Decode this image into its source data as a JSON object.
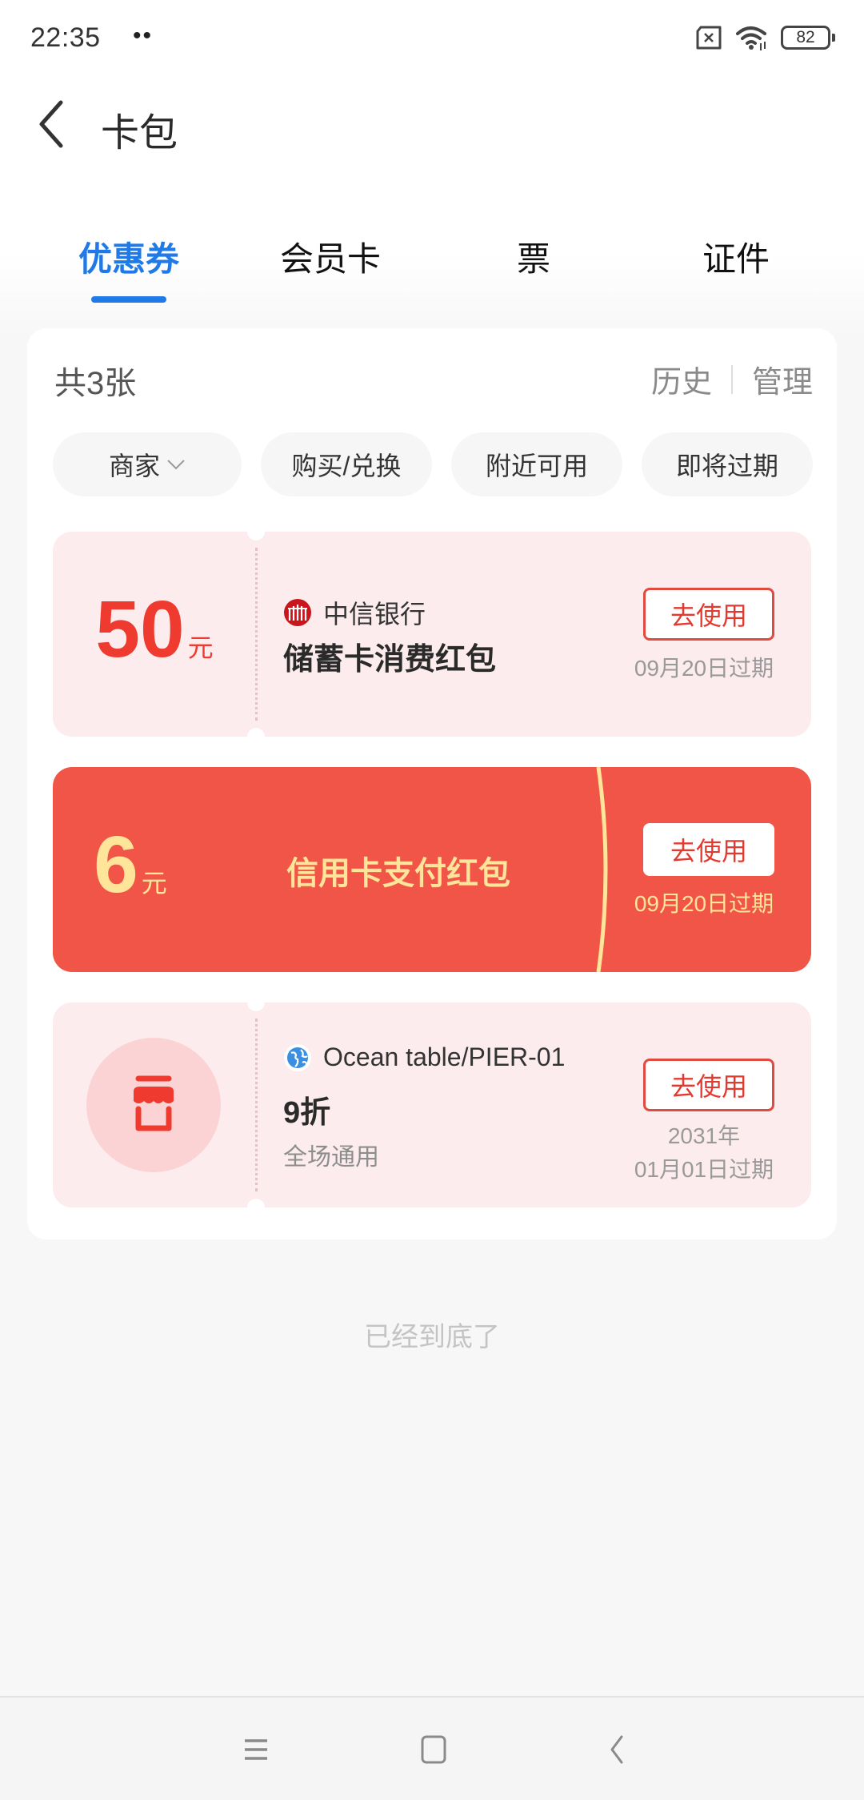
{
  "status_bar": {
    "time": "22:35",
    "dots": "••",
    "battery": "82"
  },
  "header": {
    "title": "卡包"
  },
  "tabs": [
    {
      "label": "优惠券",
      "active": true
    },
    {
      "label": "会员卡",
      "active": false
    },
    {
      "label": "票",
      "active": false
    },
    {
      "label": "证件",
      "active": false
    }
  ],
  "panel": {
    "count": "共3张",
    "history_label": "历史",
    "manage_label": "管理",
    "filters": [
      {
        "label": "商家",
        "has_dropdown": true
      },
      {
        "label": "购买/兑换"
      },
      {
        "label": "附近可用"
      },
      {
        "label": "即将过期"
      }
    ]
  },
  "coupons": [
    {
      "amount": "50",
      "unit": "元",
      "merchant": "中信银行",
      "merchant_icon": "citic-bank-logo",
      "title": "储蓄卡消费红包",
      "button": "去使用",
      "expire": "09月20日过期",
      "style": "light"
    },
    {
      "amount": "6",
      "unit": "元",
      "title": "信用卡支付红包",
      "button": "去使用",
      "expire": "09月20日过期",
      "style": "red"
    },
    {
      "icon": "store-icon",
      "merchant": "Ocean table/PIER-01",
      "merchant_icon": "globe-icon",
      "title": "9折",
      "subtitle": "全场通用",
      "button": "去使用",
      "expire_line1": "2031年",
      "expire_line2": "01月01日过期",
      "style": "light"
    }
  ],
  "bottom_hint": "已经到底了",
  "colors": {
    "accent_blue": "#1f7ae8",
    "coupon_red": "#f15547",
    "coupon_light": "#fdecee",
    "amount_red": "#ee3a2f",
    "gold": "#ffe59a"
  }
}
